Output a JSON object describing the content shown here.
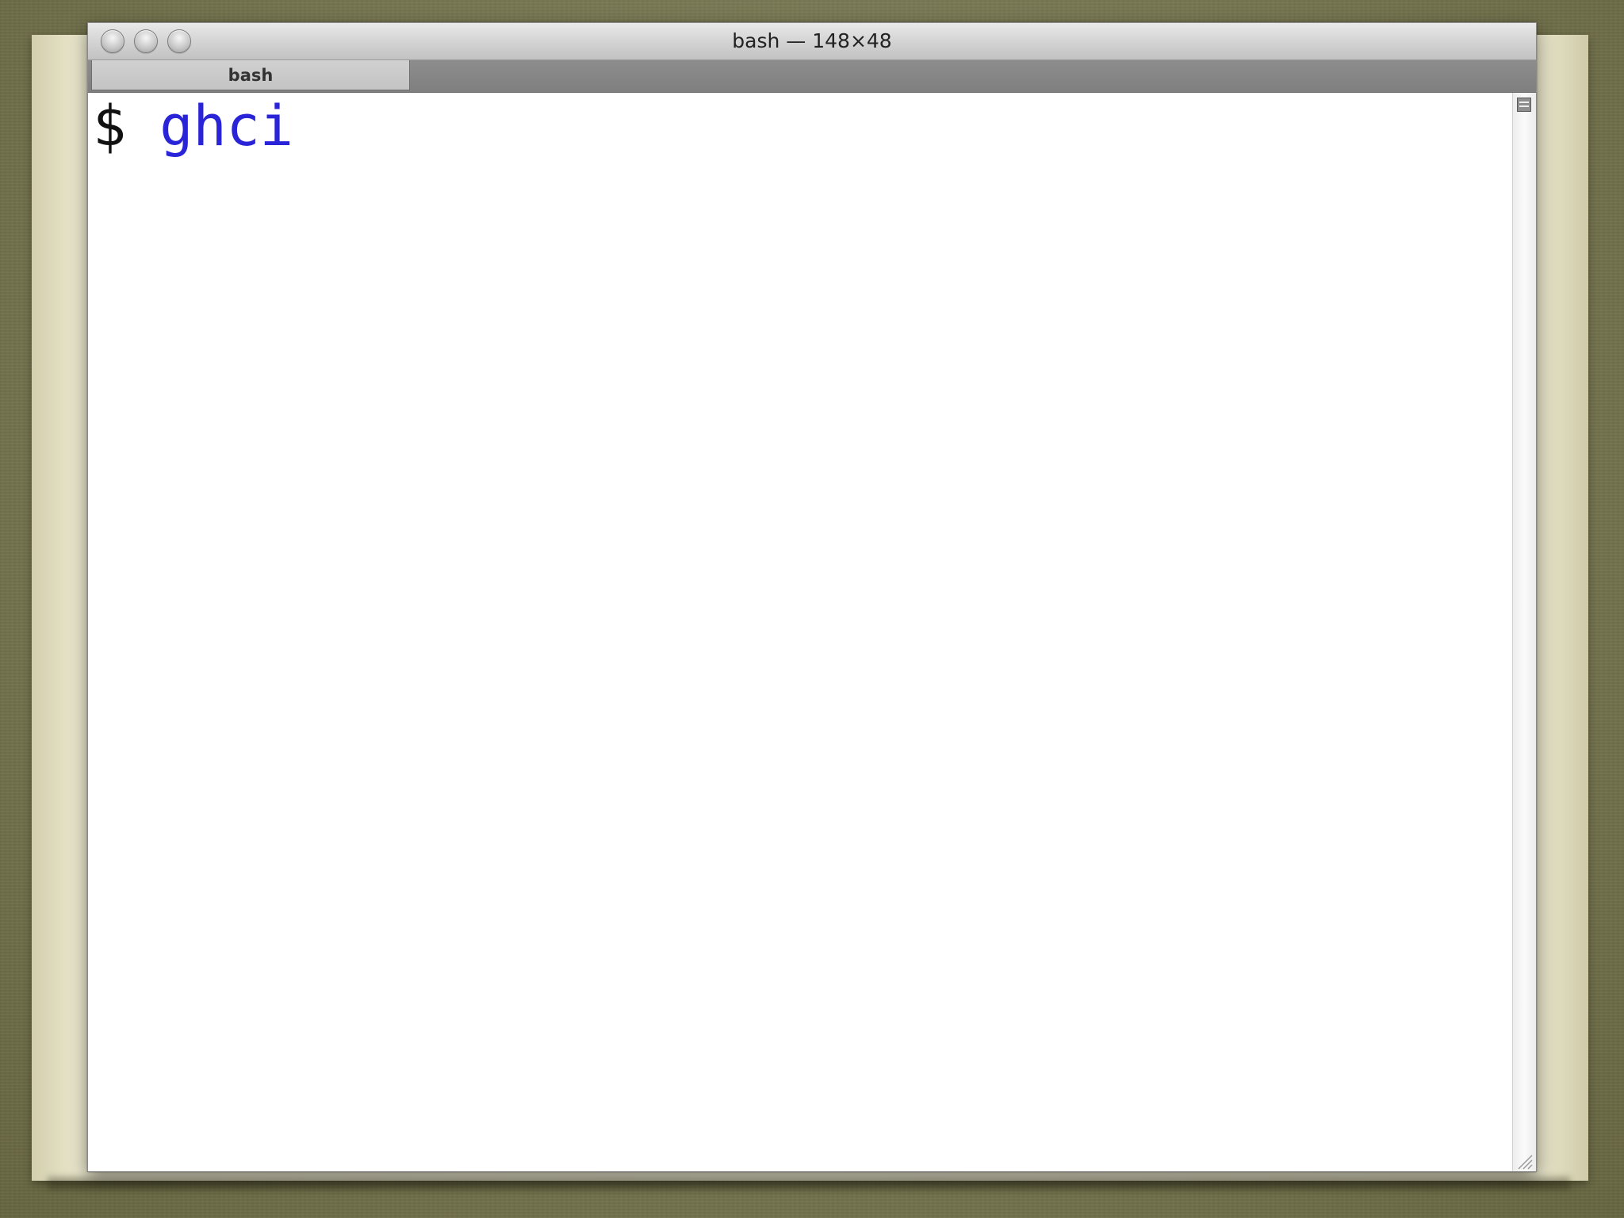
{
  "window": {
    "title": "bash — 148×48"
  },
  "tabs": [
    {
      "label": "bash",
      "active": true
    }
  ],
  "terminal": {
    "lines": [
      {
        "prompt": "$ ",
        "command": "ghci"
      }
    ],
    "prompt_color": "#111111",
    "command_color": "#2a24d9",
    "background_color": "#ffffff"
  },
  "icons": {
    "close": "close-button-icon",
    "minimize": "minimize-button-icon",
    "zoom": "zoom-button-icon",
    "split": "split-pane-icon",
    "resize": "resize-grip-icon"
  }
}
